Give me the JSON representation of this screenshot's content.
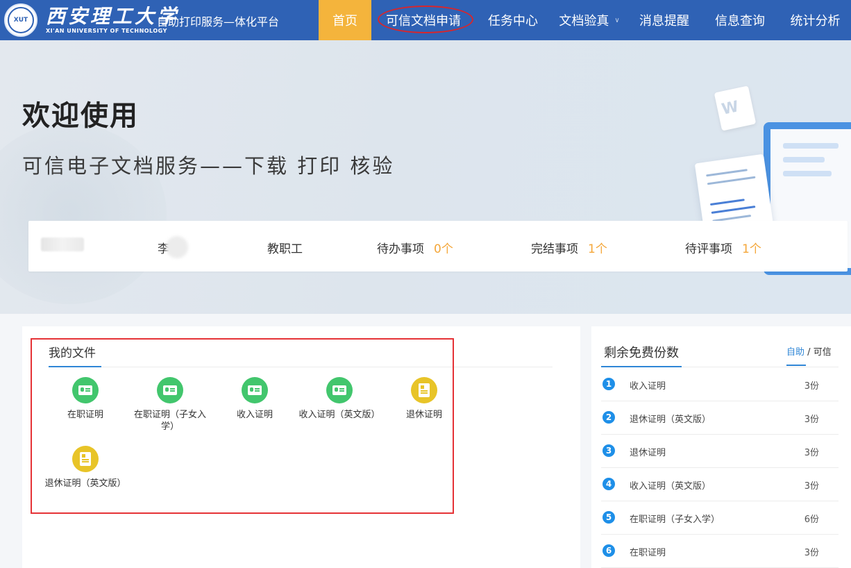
{
  "header": {
    "logo_cn": "西安理工大学",
    "logo_en": "XI'AN UNIVERSITY OF TECHNOLOGY",
    "platform_title": "自助打印服务—体化平台",
    "nav": [
      {
        "label": "首页"
      },
      {
        "label": "可信文档申请"
      },
      {
        "label": "任务中心"
      },
      {
        "label": "文档验真"
      },
      {
        "label": "消息提醒"
      },
      {
        "label": "信息查询"
      },
      {
        "label": "统计分析"
      }
    ]
  },
  "banner": {
    "welcome": "欢迎使用",
    "subtitle": "可信电子文档服务——下载 打印 核验"
  },
  "user_info": {
    "name": "李",
    "role": "教职工",
    "pending_label": "待办事项",
    "pending_count": "0个",
    "done_label": "完结事项",
    "done_count": "1个",
    "review_label": "待评事项",
    "review_count": "1个"
  },
  "my_files": {
    "title": "我的文件",
    "items": [
      {
        "label": "在职证明",
        "color": "green",
        "icon": "id-card-icon"
      },
      {
        "label": "在职证明（子女入学）",
        "color": "green",
        "icon": "id-card-icon"
      },
      {
        "label": "收入证明",
        "color": "green",
        "icon": "id-card-icon"
      },
      {
        "label": "收入证明（英文版）",
        "color": "green",
        "icon": "id-card-icon"
      },
      {
        "label": "退休证明",
        "color": "yellow",
        "icon": "document-icon"
      },
      {
        "label": "退休证明（英文版）",
        "color": "yellow",
        "icon": "document-icon"
      }
    ]
  },
  "free_copies": {
    "title": "剩余免费份数",
    "tab_active": "自助",
    "tab_sep": "/",
    "tab_other": "可信",
    "rows": [
      {
        "num": "1",
        "name": "收入证明",
        "count": "3份"
      },
      {
        "num": "2",
        "name": "退休证明（英文版）",
        "count": "3份"
      },
      {
        "num": "3",
        "name": "退休证明",
        "count": "3份"
      },
      {
        "num": "4",
        "name": "收入证明（英文版）",
        "count": "3份"
      },
      {
        "num": "5",
        "name": "在职证明（子女入学）",
        "count": "6份"
      },
      {
        "num": "6",
        "name": "在职证明",
        "count": "3份"
      }
    ]
  },
  "colors": {
    "brand_blue": "#2f62b5",
    "active_nav": "#f4b43c",
    "accent_blue": "#2f86d6",
    "count_orange": "#f4a638",
    "highlight_red": "#e53236"
  }
}
